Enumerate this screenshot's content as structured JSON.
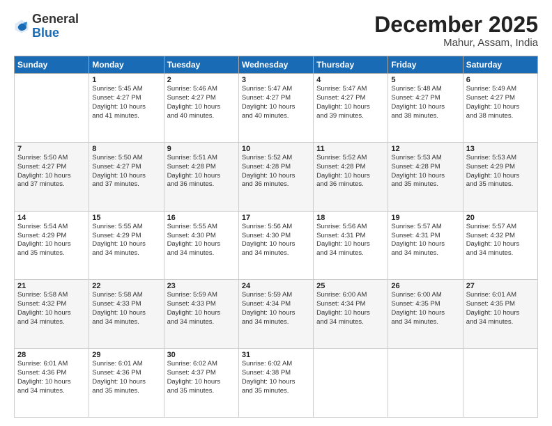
{
  "header": {
    "logo_general": "General",
    "logo_blue": "Blue",
    "month_year": "December 2025",
    "location": "Mahur, Assam, India"
  },
  "weekdays": [
    "Sunday",
    "Monday",
    "Tuesday",
    "Wednesday",
    "Thursday",
    "Friday",
    "Saturday"
  ],
  "weeks": [
    [
      {
        "day": "",
        "info": ""
      },
      {
        "day": "1",
        "info": "Sunrise: 5:45 AM\nSunset: 4:27 PM\nDaylight: 10 hours\nand 41 minutes."
      },
      {
        "day": "2",
        "info": "Sunrise: 5:46 AM\nSunset: 4:27 PM\nDaylight: 10 hours\nand 40 minutes."
      },
      {
        "day": "3",
        "info": "Sunrise: 5:47 AM\nSunset: 4:27 PM\nDaylight: 10 hours\nand 40 minutes."
      },
      {
        "day": "4",
        "info": "Sunrise: 5:47 AM\nSunset: 4:27 PM\nDaylight: 10 hours\nand 39 minutes."
      },
      {
        "day": "5",
        "info": "Sunrise: 5:48 AM\nSunset: 4:27 PM\nDaylight: 10 hours\nand 38 minutes."
      },
      {
        "day": "6",
        "info": "Sunrise: 5:49 AM\nSunset: 4:27 PM\nDaylight: 10 hours\nand 38 minutes."
      }
    ],
    [
      {
        "day": "7",
        "info": "Sunrise: 5:50 AM\nSunset: 4:27 PM\nDaylight: 10 hours\nand 37 minutes."
      },
      {
        "day": "8",
        "info": "Sunrise: 5:50 AM\nSunset: 4:27 PM\nDaylight: 10 hours\nand 37 minutes."
      },
      {
        "day": "9",
        "info": "Sunrise: 5:51 AM\nSunset: 4:28 PM\nDaylight: 10 hours\nand 36 minutes."
      },
      {
        "day": "10",
        "info": "Sunrise: 5:52 AM\nSunset: 4:28 PM\nDaylight: 10 hours\nand 36 minutes."
      },
      {
        "day": "11",
        "info": "Sunrise: 5:52 AM\nSunset: 4:28 PM\nDaylight: 10 hours\nand 36 minutes."
      },
      {
        "day": "12",
        "info": "Sunrise: 5:53 AM\nSunset: 4:28 PM\nDaylight: 10 hours\nand 35 minutes."
      },
      {
        "day": "13",
        "info": "Sunrise: 5:53 AM\nSunset: 4:29 PM\nDaylight: 10 hours\nand 35 minutes."
      }
    ],
    [
      {
        "day": "14",
        "info": "Sunrise: 5:54 AM\nSunset: 4:29 PM\nDaylight: 10 hours\nand 35 minutes."
      },
      {
        "day": "15",
        "info": "Sunrise: 5:55 AM\nSunset: 4:29 PM\nDaylight: 10 hours\nand 34 minutes."
      },
      {
        "day": "16",
        "info": "Sunrise: 5:55 AM\nSunset: 4:30 PM\nDaylight: 10 hours\nand 34 minutes."
      },
      {
        "day": "17",
        "info": "Sunrise: 5:56 AM\nSunset: 4:30 PM\nDaylight: 10 hours\nand 34 minutes."
      },
      {
        "day": "18",
        "info": "Sunrise: 5:56 AM\nSunset: 4:31 PM\nDaylight: 10 hours\nand 34 minutes."
      },
      {
        "day": "19",
        "info": "Sunrise: 5:57 AM\nSunset: 4:31 PM\nDaylight: 10 hours\nand 34 minutes."
      },
      {
        "day": "20",
        "info": "Sunrise: 5:57 AM\nSunset: 4:32 PM\nDaylight: 10 hours\nand 34 minutes."
      }
    ],
    [
      {
        "day": "21",
        "info": "Sunrise: 5:58 AM\nSunset: 4:32 PM\nDaylight: 10 hours\nand 34 minutes."
      },
      {
        "day": "22",
        "info": "Sunrise: 5:58 AM\nSunset: 4:33 PM\nDaylight: 10 hours\nand 34 minutes."
      },
      {
        "day": "23",
        "info": "Sunrise: 5:59 AM\nSunset: 4:33 PM\nDaylight: 10 hours\nand 34 minutes."
      },
      {
        "day": "24",
        "info": "Sunrise: 5:59 AM\nSunset: 4:34 PM\nDaylight: 10 hours\nand 34 minutes."
      },
      {
        "day": "25",
        "info": "Sunrise: 6:00 AM\nSunset: 4:34 PM\nDaylight: 10 hours\nand 34 minutes."
      },
      {
        "day": "26",
        "info": "Sunrise: 6:00 AM\nSunset: 4:35 PM\nDaylight: 10 hours\nand 34 minutes."
      },
      {
        "day": "27",
        "info": "Sunrise: 6:01 AM\nSunset: 4:35 PM\nDaylight: 10 hours\nand 34 minutes."
      }
    ],
    [
      {
        "day": "28",
        "info": "Sunrise: 6:01 AM\nSunset: 4:36 PM\nDaylight: 10 hours\nand 34 minutes."
      },
      {
        "day": "29",
        "info": "Sunrise: 6:01 AM\nSunset: 4:36 PM\nDaylight: 10 hours\nand 35 minutes."
      },
      {
        "day": "30",
        "info": "Sunrise: 6:02 AM\nSunset: 4:37 PM\nDaylight: 10 hours\nand 35 minutes."
      },
      {
        "day": "31",
        "info": "Sunrise: 6:02 AM\nSunset: 4:38 PM\nDaylight: 10 hours\nand 35 minutes."
      },
      {
        "day": "",
        "info": ""
      },
      {
        "day": "",
        "info": ""
      },
      {
        "day": "",
        "info": ""
      }
    ]
  ]
}
